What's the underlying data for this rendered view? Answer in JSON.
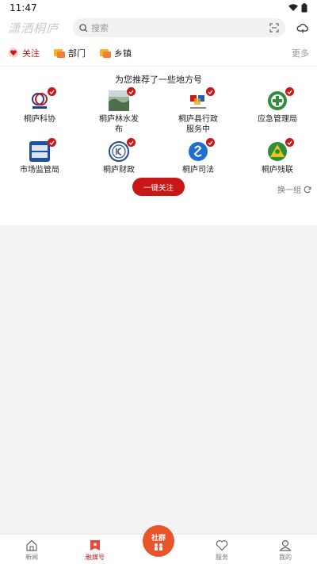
{
  "status": {
    "time": "11:47"
  },
  "header": {
    "logo_text": "潇洒桐庐",
    "search_placeholder": "搜索"
  },
  "tabs": [
    {
      "label": "关注"
    },
    {
      "label": "部门"
    },
    {
      "label": "乡镇"
    }
  ],
  "tabs_more": "更多",
  "recommend": {
    "title": "为您推荐了一些地方号",
    "items": [
      {
        "name": "桐庐科协"
      },
      {
        "name": "桐庐林水发布"
      },
      {
        "name": "桐庐县行政服务中"
      },
      {
        "name": "应急管理局"
      },
      {
        "name": "市场监管局"
      },
      {
        "name": "桐庐财政"
      },
      {
        "name": "桐庐司法"
      },
      {
        "name": "桐庐残联"
      }
    ],
    "follow_all": "一键关注",
    "refresh": "换一组"
  },
  "bottom_nav": {
    "items": [
      {
        "label": "新闻"
      },
      {
        "label": "融媒号"
      },
      {
        "label": ""
      },
      {
        "label": "服务"
      },
      {
        "label": "我的"
      }
    ],
    "center": "社群"
  },
  "colors": {
    "accent": "#c71717",
    "center": "#e9542a"
  }
}
